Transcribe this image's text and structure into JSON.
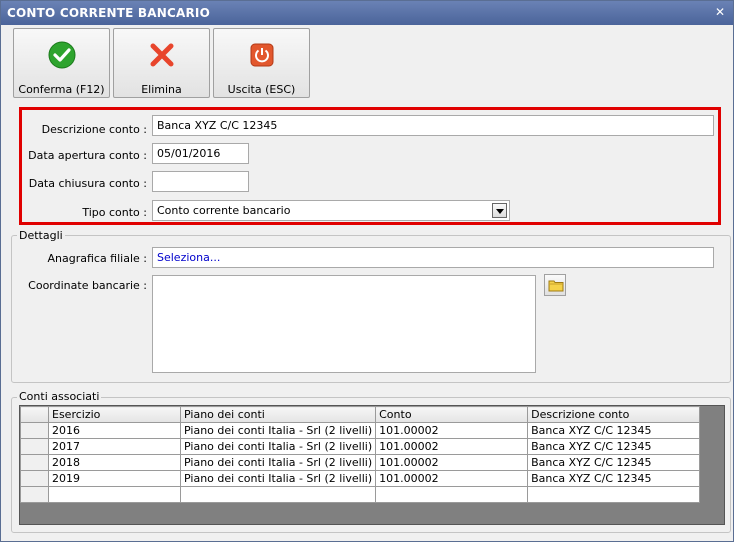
{
  "window": {
    "title": "CONTO CORRENTE BANCARIO",
    "close_glyph": "✕"
  },
  "toolbar": {
    "confirm_label": "Conferma (F12)",
    "delete_label": "Elimina",
    "exit_label": "Uscita (ESC)"
  },
  "form": {
    "description_label": "Descrizione conto :",
    "description_value": "Banca XYZ C/C 12345",
    "open_date_label": "Data apertura conto :",
    "open_date_value": "05/01/2016",
    "close_date_label": "Data chiusura conto :",
    "close_date_value": "",
    "account_type_label": "Tipo conto :",
    "account_type_value": "Conto corrente bancario"
  },
  "details": {
    "group_title": "Dettagli",
    "branch_label": "Anagrafica filiale :",
    "branch_value": "Seleziona...",
    "bank_coords_label": "Coordinate bancarie :",
    "bank_coords_value": ""
  },
  "linked": {
    "group_title": "Conti associati",
    "columns": [
      "Esercizio",
      "Piano dei conti",
      "Conto",
      "Descrizione conto"
    ],
    "rows": [
      [
        "2016",
        "Piano dei conti Italia - Srl (2 livelli)",
        "101.00002",
        "Banca XYZ C/C 12345"
      ],
      [
        "2017",
        "Piano dei conti Italia - Srl (2 livelli)",
        "101.00002",
        "Banca XYZ C/C 12345"
      ],
      [
        "2018",
        "Piano dei conti Italia - Srl (2 livelli)",
        "101.00002",
        "Banca XYZ C/C 12345"
      ],
      [
        "2019",
        "Piano dei conti Italia - Srl (2 livelli)",
        "101.00002",
        "Banca XYZ C/C 12345"
      ]
    ]
  },
  "colors": {
    "title_bar": "#5470a6",
    "highlight_border": "#e00000",
    "link": "#0000cc"
  }
}
